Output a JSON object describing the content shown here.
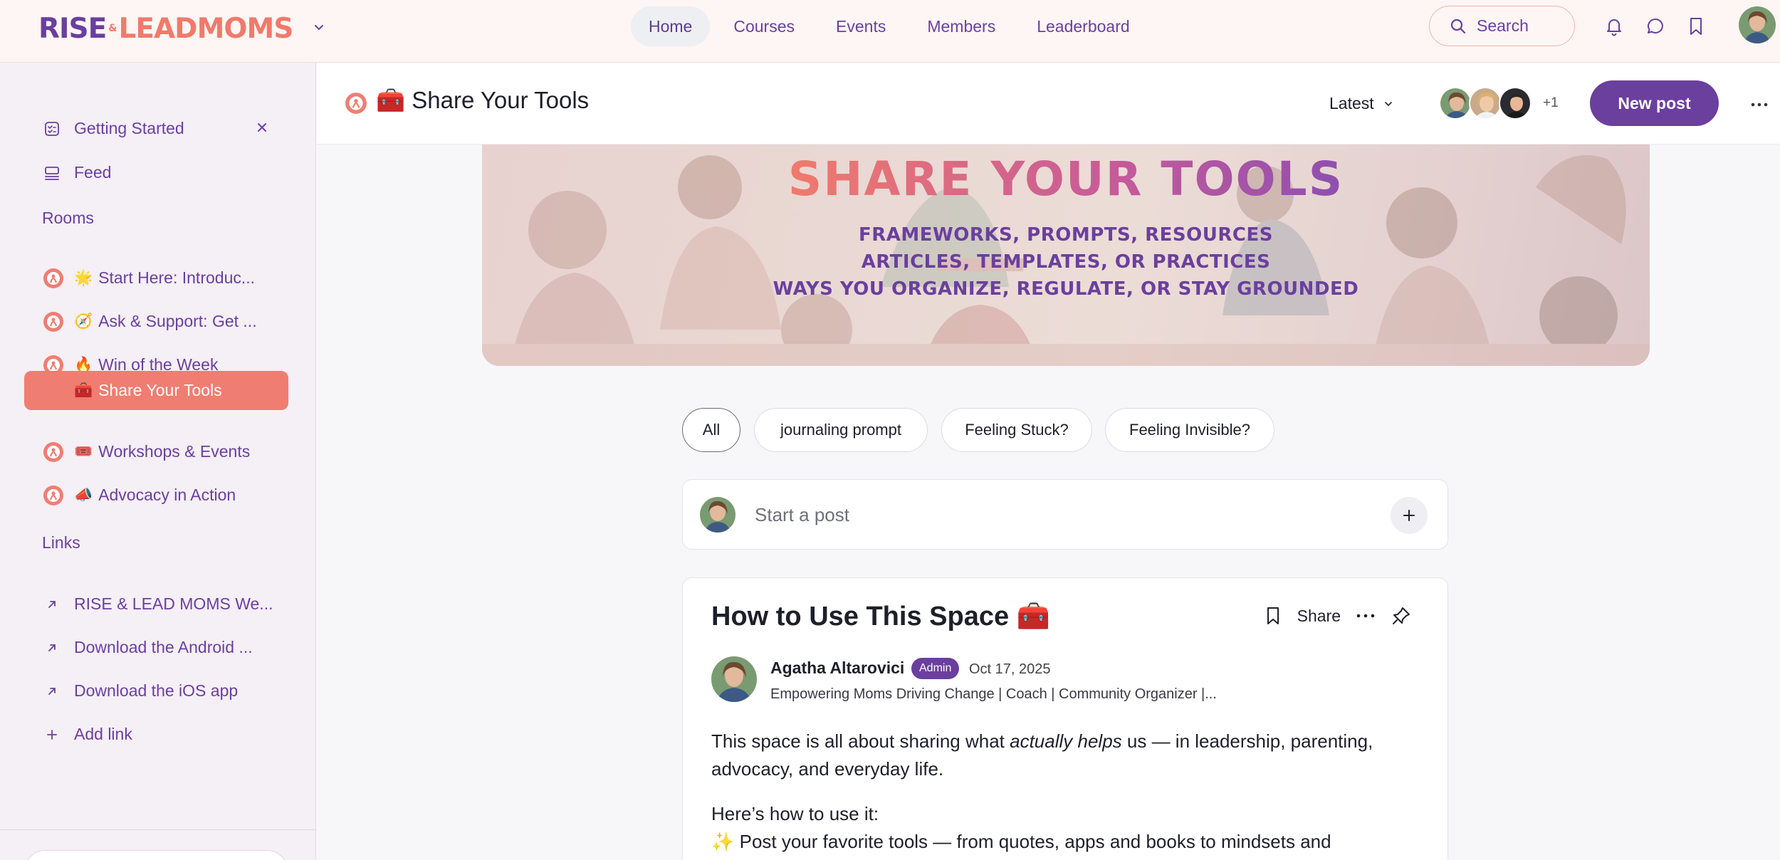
{
  "topbar": {
    "logo": {
      "rise": "RISE",
      "amp": "&",
      "lead": "LEAD",
      "moms": "MOMS"
    },
    "nav": [
      {
        "label": "Home",
        "active": true
      },
      {
        "label": "Courses"
      },
      {
        "label": "Events"
      },
      {
        "label": "Members"
      },
      {
        "label": "Leaderboard"
      }
    ],
    "search_label": "Search",
    "icons": [
      "bell-icon",
      "chat-bubble-icon",
      "bookmark-icon",
      "user-avatar"
    ]
  },
  "sidebar": {
    "getting_started": "Getting Started",
    "feed": "Feed",
    "rooms_heading": "Rooms",
    "rooms": [
      {
        "emoji": "🌟",
        "label": "Start Here: Introduc..."
      },
      {
        "emoji": "🧭",
        "label": "Ask & Support: Get ..."
      },
      {
        "emoji": "🔥",
        "label": "Win of the Week"
      },
      {
        "emoji": "🧰",
        "label": "Share Your Tools",
        "active": true
      },
      {
        "emoji": "🎟️",
        "label": "Workshops & Events"
      },
      {
        "emoji": "📣",
        "label": "Advocacy in Action"
      }
    ],
    "links_heading": "Links",
    "links": [
      {
        "label": "RISE & LEAD MOMS We..."
      },
      {
        "label": "Download the Android ..."
      },
      {
        "label": "Download the iOS app"
      }
    ],
    "add_link": "Add link"
  },
  "header": {
    "title": "🧰 Share Your Tools",
    "sort_label": "Latest",
    "member_more": "+1",
    "new_post": "New post"
  },
  "banner": {
    "title": "SHARE YOUR TOOLS",
    "lines": [
      "FRAMEWORKS, PROMPTS, RESOURCES",
      "ARTICLES, TEMPLATES, OR PRACTICES",
      "WAYS YOU ORGANIZE, REGULATE, OR STAY GROUNDED"
    ]
  },
  "filters": [
    {
      "label": "All",
      "active": true
    },
    {
      "label": "journaling prompt"
    },
    {
      "label": "Feeling Stuck?"
    },
    {
      "label": "Feeling Invisible?"
    }
  ],
  "composer": {
    "placeholder": "Start a post"
  },
  "post": {
    "title": "How to Use This Space 🧰",
    "share_label": "Share",
    "author": "Agatha Altarovici",
    "badge": "Admin",
    "date": "Oct 17, 2025",
    "bio": "Empowering Moms Driving Change | Coach | Community Organizer |...",
    "body_p1_start": "This space is all about sharing what ",
    "body_p1_em": "actually helps",
    "body_p1_end": " us — in leadership, parenting, advocacy, and everyday life.",
    "body_p2": "Here’s how to use it:",
    "body_p3": "✨ Post your favorite tools — from quotes, apps and books to mindsets and"
  },
  "colors": {
    "brand_purple": "#6b3f9e",
    "brand_coral": "#f07d72"
  }
}
